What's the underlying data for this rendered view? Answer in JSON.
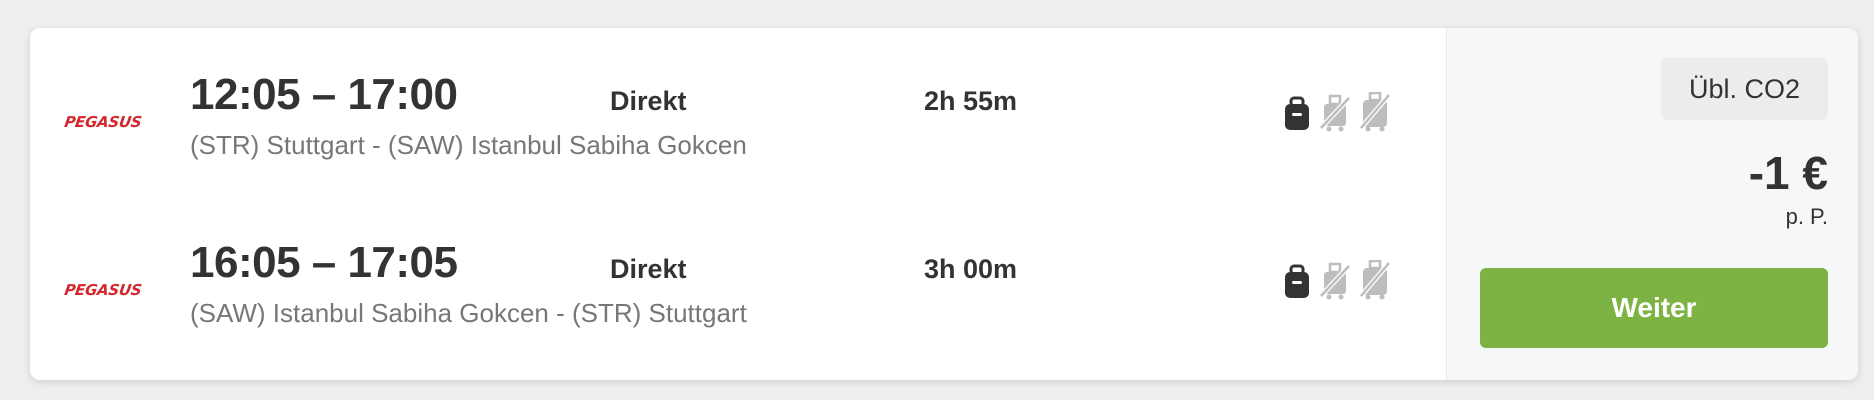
{
  "itinerary": {
    "outbound": {
      "airline_logo_text": "PEGASUS",
      "times": "12:05 – 17:00",
      "route": "(STR) Stuttgart - (SAW) Istanbul Sabiha Gokcen",
      "stops": "Direkt",
      "duration": "2h 55m",
      "baggage_icons": [
        "personal-item-icon",
        "cabin-bag-not-included-icon",
        "checked-bag-not-included-icon"
      ]
    },
    "inbound": {
      "airline_logo_text": "PEGASUS",
      "times": "16:05 – 17:05",
      "route": "(SAW) Istanbul Sabiha Gokcen - (STR) Stuttgart",
      "stops": "Direkt",
      "duration": "3h 00m",
      "baggage_icons": [
        "personal-item-icon",
        "cabin-bag-not-included-icon",
        "checked-bag-not-included-icon"
      ]
    }
  },
  "pricing": {
    "co2_label": "Übl. CO2",
    "price": "-1 €",
    "per_person": "p. P.",
    "cta_label": "Weiter"
  },
  "colors": {
    "airline_brand": "#d6262d",
    "cta_green": "#7db343",
    "text_dark": "#333333",
    "text_muted": "#777777",
    "icon_inactive": "#bdbdbd"
  }
}
